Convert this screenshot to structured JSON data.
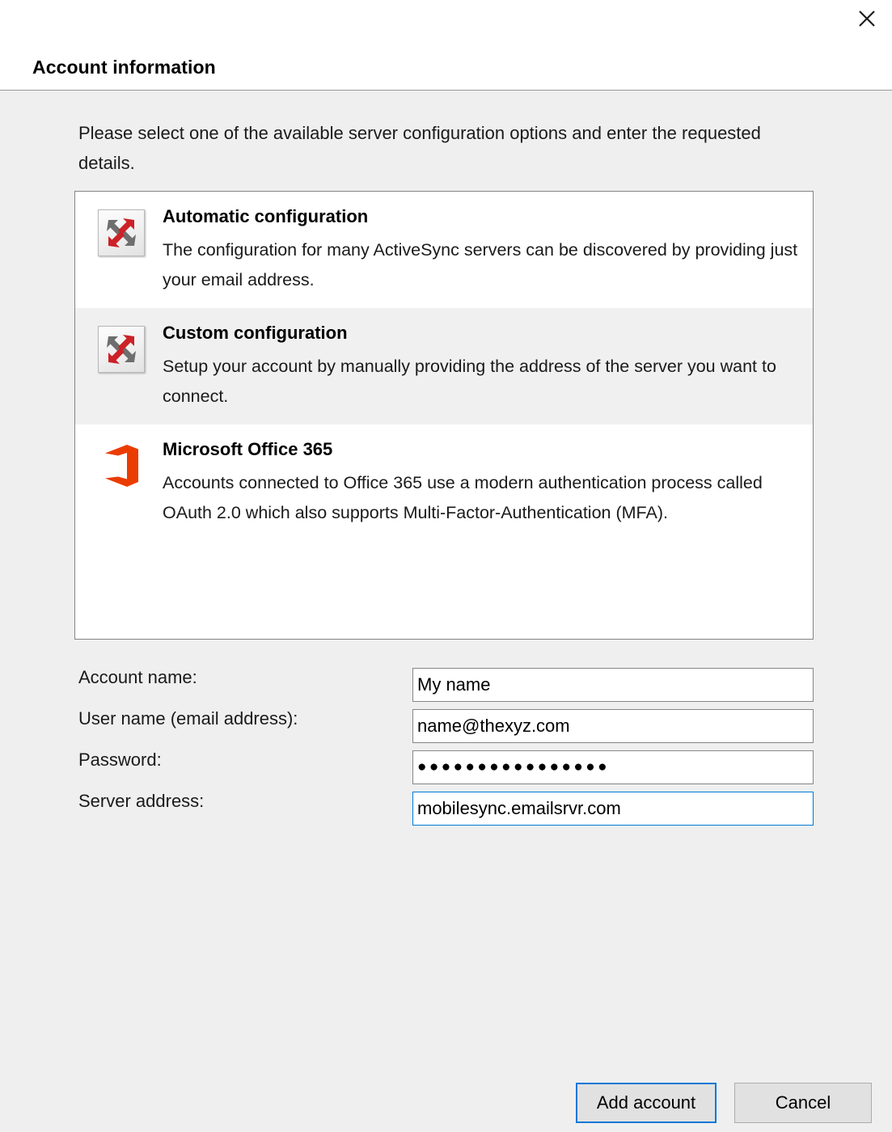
{
  "window": {
    "title": "Account information",
    "close_icon": "close-icon"
  },
  "intro": "Please select one of the available server configuration options and enter the requested details.",
  "options": [
    {
      "icon": "activesync-exchange-icon",
      "title": "Automatic configuration",
      "description": "The configuration for many ActiveSync servers can be discovered by providing just your email address.",
      "selected": false
    },
    {
      "icon": "activesync-exchange-icon",
      "title": "Custom configuration",
      "description": "Setup your account by manually providing the address of the server you want to connect.",
      "selected": true
    },
    {
      "icon": "microsoft-office-365-icon",
      "title": "Microsoft Office 365",
      "description": "Accounts connected to Office 365 use a modern authentication process called OAuth 2.0 which also supports Multi-Factor-Authentication (MFA).",
      "selected": false
    }
  ],
  "form": {
    "account_name": {
      "label": "Account name:",
      "value": "My name"
    },
    "user_name": {
      "label": "User name (email address):",
      "value": "name@thexyz.com"
    },
    "password": {
      "label": "Password:",
      "value": "●●●●●●●●●●●●●●●●"
    },
    "server_address": {
      "label": "Server address:",
      "value": "mobilesync.emailsrvr.com"
    }
  },
  "footer": {
    "add_account_label": "Add account",
    "cancel_label": "Cancel"
  },
  "colors": {
    "accent": "#0078d7",
    "dialog_background": "#efefef",
    "selected_row": "#f0f0f0",
    "office_orange": "#eb3c00"
  }
}
